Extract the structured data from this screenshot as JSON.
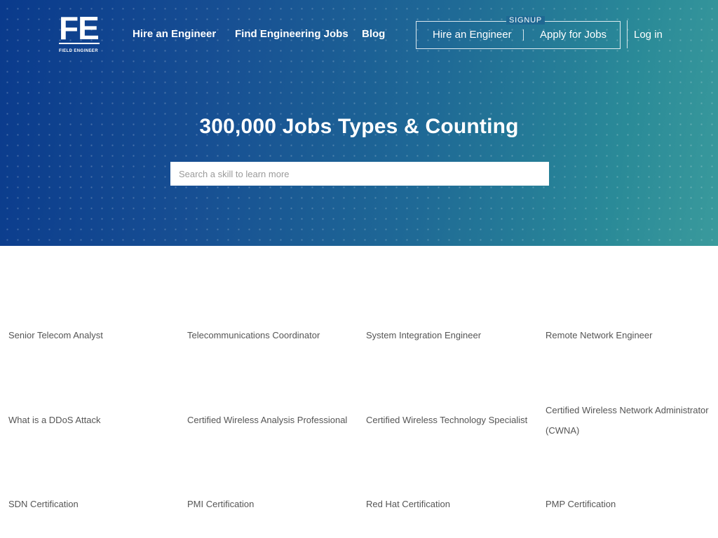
{
  "logo": {
    "mark": "FE",
    "subtitle": "FIELD ENGINEER"
  },
  "nav": {
    "hire": "Hire an Engineer",
    "find_jobs": "Find Engineering Jobs",
    "blog": "Blog"
  },
  "signup": {
    "label": "SIGNUP",
    "hire": "Hire an Engineer",
    "apply": "Apply for Jobs"
  },
  "login": "Log in",
  "hero": {
    "title": "300,000 Jobs Types & Counting",
    "search_placeholder": "Search a skill to learn more"
  },
  "skills": [
    [
      "Senior Telecom Analyst",
      "Telecommunications Coordinator",
      "System Integration Engineer",
      "Remote Network Engineer"
    ],
    [
      "What is a DDoS Attack",
      "Certified Wireless Analysis Professional",
      "Certified Wireless Technology Specialist",
      "Certified Wireless Network Administrator (CWNA)"
    ],
    [
      "SDN Certification",
      "PMI Certification",
      "Red Hat Certification",
      "PMP Certification"
    ]
  ]
}
